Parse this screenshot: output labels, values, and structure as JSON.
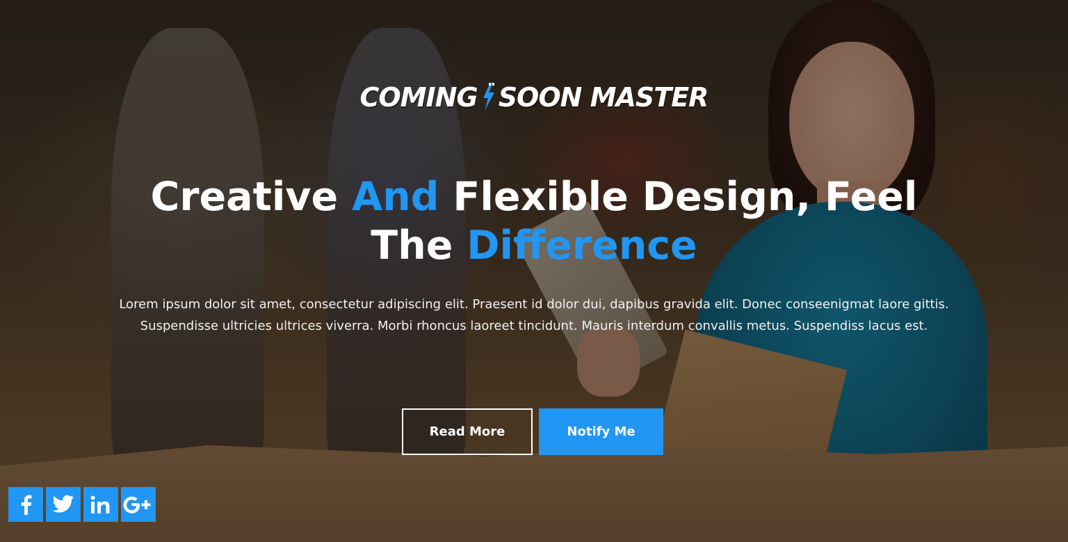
{
  "brand": {
    "logo_left": "COMING",
    "logo_right": "SOON MASTER"
  },
  "hero": {
    "headline_parts": [
      "Creative ",
      "And",
      " Flexible Design, Feel The ",
      "Difference"
    ],
    "description": "Lorem ipsum dolor sit amet, consectetur adipiscing elit. Praesent id dolor dui, dapibus gravida elit. Donec conseenigmat laore gittis. Suspendisse ultricies ultrices viverra. Morbi rhoncus laoreet tincidunt. Mauris interdum convallis metus. Suspendiss lacus est."
  },
  "buttons": {
    "read_more": "Read More",
    "notify_me": "Notify Me"
  },
  "social": {
    "icons": [
      "facebook-icon",
      "twitter-icon",
      "linkedin-icon",
      "google-plus-icon"
    ]
  },
  "colors": {
    "accent": "#2196f3",
    "text": "#ffffff"
  }
}
